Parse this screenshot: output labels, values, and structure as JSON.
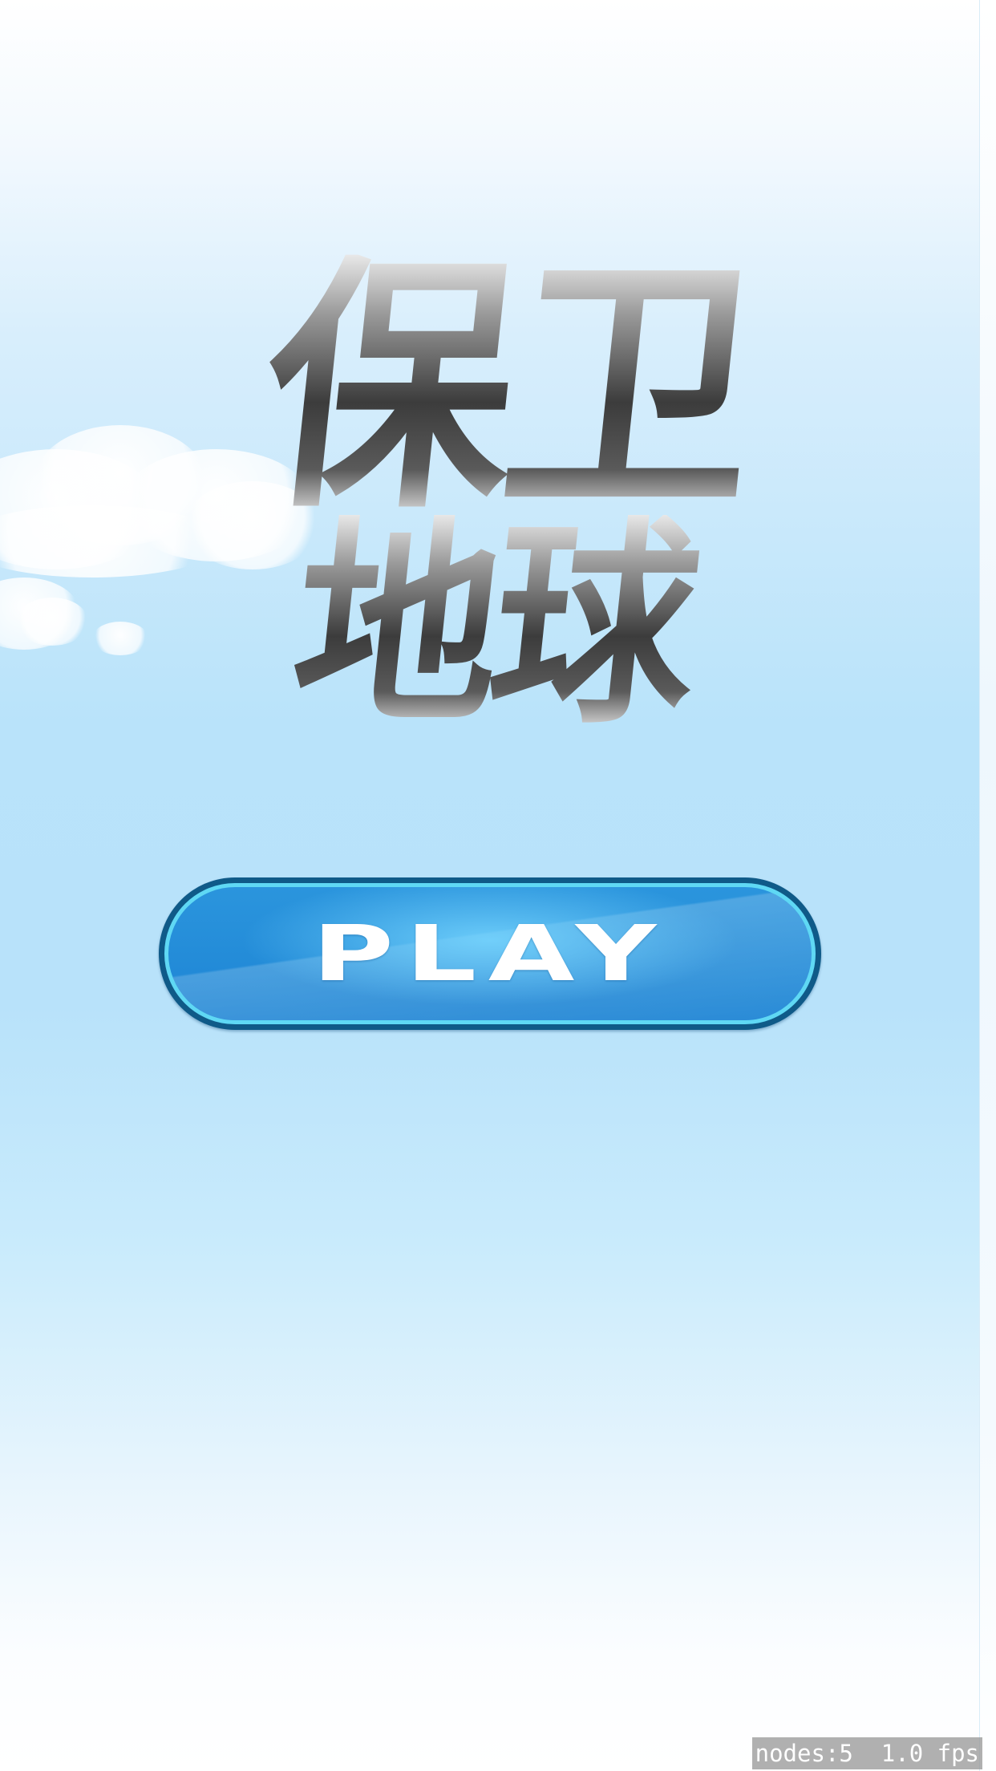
{
  "title": {
    "line1": "保卫",
    "line2": "地球"
  },
  "play_button": {
    "label": "PLAY"
  },
  "stats": {
    "nodes": "nodes:5",
    "fps": "1.0 fps"
  },
  "colors": {
    "sky_top": "#ffffff",
    "sky_mid": "#b9e3fa",
    "button_fill": "#1d84d4",
    "button_border": "#0f5a88",
    "button_ring": "#5fd8f4"
  }
}
